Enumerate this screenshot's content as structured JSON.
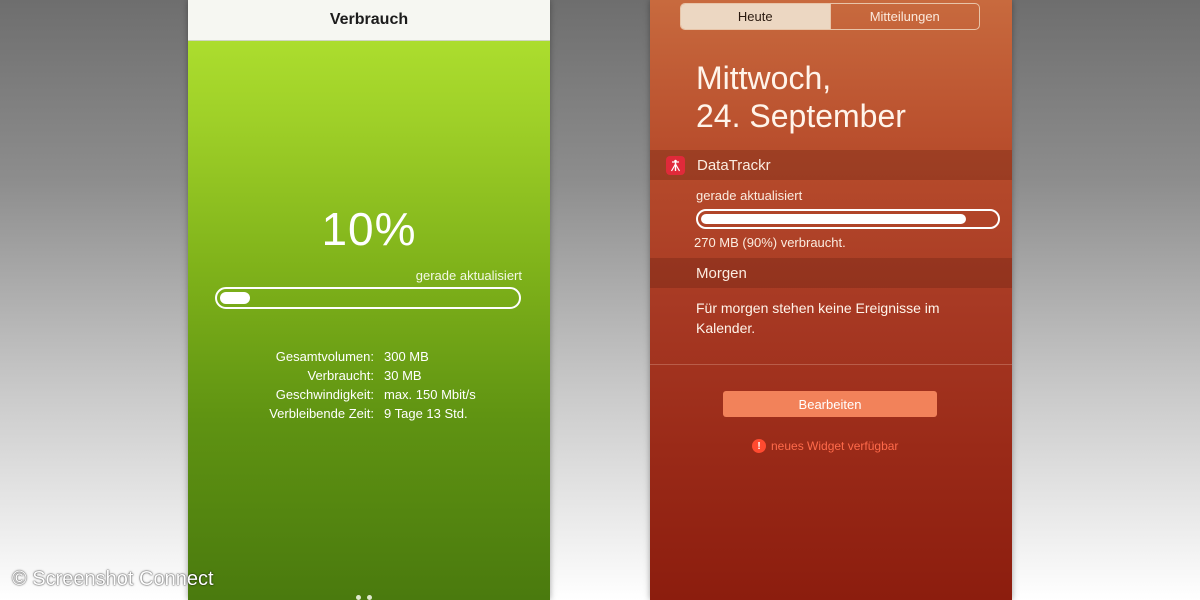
{
  "left_app": {
    "nav_title": "Verbrauch",
    "percent_text": "10%",
    "updated_text": "gerade aktualisiert",
    "progress_fraction": 0.1,
    "stats": [
      {
        "label": "Gesamtvolumen:",
        "value": "300 MB"
      },
      {
        "label": "Verbraucht:",
        "value": "30 MB"
      },
      {
        "label": "Geschwindigkeit:",
        "value": "max. 150 Mbit/s"
      },
      {
        "label": "Verbleibende Zeit:",
        "value": "9 Tage 13 Std."
      }
    ],
    "colors": {
      "accent": "#8cc21f",
      "nav_bg": "#f6f7f2"
    }
  },
  "right_app": {
    "tabs": [
      {
        "label": "Heute",
        "active": true
      },
      {
        "label": "Mitteilungen",
        "active": false
      }
    ],
    "date_line1": "Mittwoch,",
    "date_line2": "24. September",
    "widget": {
      "app_name": "DataTrackr",
      "app_icon": "datatrackr-app-icon",
      "updated_text": "gerade aktualisiert",
      "progress_fraction": 0.9,
      "consumed_text": "270 MB (90%) verbraucht."
    },
    "tomorrow": {
      "header": "Morgen",
      "text": "Für morgen stehen keine Ereignisse im Kalender."
    },
    "edit_button": "Bearbeiten",
    "new_widget": {
      "icon": "warning-circle-icon",
      "icon_glyph": "!",
      "text": "neues Widget verfügbar"
    },
    "colors": {
      "accent": "#f2825a",
      "warning": "#ff4a30"
    }
  },
  "watermark": "© Screenshot Connect"
}
